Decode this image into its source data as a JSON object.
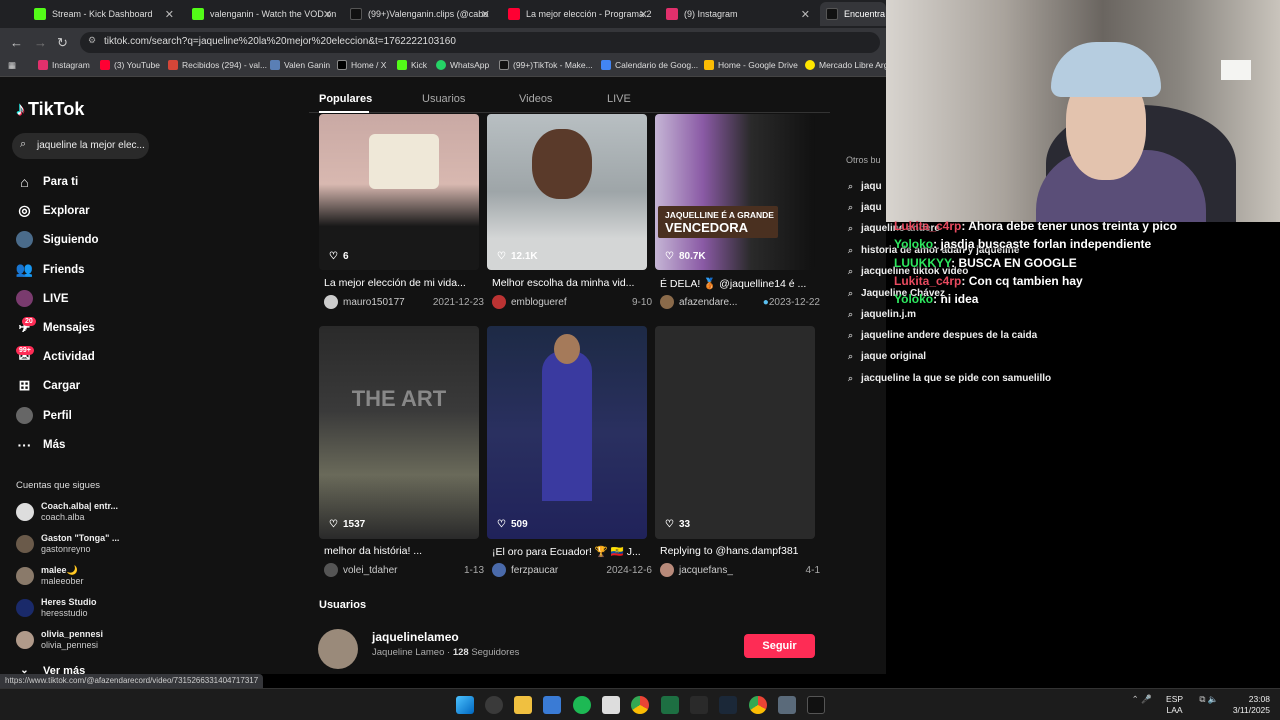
{
  "browser": {
    "tabs": [
      {
        "title": "Stream - Kick Dashboard",
        "color": "#53fc18"
      },
      {
        "title": "valenganin - Watch the VOD on",
        "color": "#53fc18"
      },
      {
        "title": "(99+)Valenganin.clips (@cabo",
        "color": "#000000"
      },
      {
        "title": "La mejor elección - Programa 2",
        "color": "#ff0033"
      },
      {
        "title": "(9) Instagram",
        "color": "#e1306c"
      },
      {
        "title": "Encuentra 'ja",
        "color": "#000000"
      }
    ],
    "url": "tiktok.com/search?q=jaqueline%20la%20mejor%20eleccion&t=1762222103160",
    "bookmarks": [
      "Instagram",
      "(3) YouTube",
      "Recibidos (294) - val...",
      "Valen Ganin",
      "Home / X",
      "Kick",
      "WhatsApp",
      "(99+)TikTok - Make...",
      "Calendario de Goog...",
      "Home - Google Drive",
      "Mercado Libre Arg"
    ]
  },
  "tiktok": {
    "logo": "TikTok",
    "search_value": "jaqueline la mejor elec...",
    "nav": [
      {
        "label": "Para ti",
        "icon": "home-icon"
      },
      {
        "label": "Explorar",
        "icon": "compass-icon"
      },
      {
        "label": "Siguiendo",
        "icon": "following-icon"
      },
      {
        "label": "Friends",
        "icon": "friends-icon"
      },
      {
        "label": "LIVE",
        "icon": "live-icon"
      },
      {
        "label": "Mensajes",
        "icon": "messages-icon",
        "badge": "20"
      },
      {
        "label": "Actividad",
        "icon": "activity-icon",
        "badge": "99+"
      },
      {
        "label": "Cargar",
        "icon": "upload-icon"
      },
      {
        "label": "Perfil",
        "icon": "profile-icon"
      },
      {
        "label": "Más",
        "icon": "more-icon"
      }
    ],
    "following_header": "Cuentas que sigues",
    "following": [
      {
        "name": "Coach.alba| entr...",
        "handle": "coach.alba"
      },
      {
        "name": "Gaston \"Tonga\" ...",
        "handle": "gastonreyno"
      },
      {
        "name": "malee🌙",
        "handle": "maleeober"
      },
      {
        "name": "Heres Studio",
        "handle": "heresstudio"
      },
      {
        "name": "olivia_pennesi",
        "handle": "olivia_pennesi"
      }
    ],
    "see_more": "Ver más",
    "tabs": [
      "Populares",
      "Usuarios",
      "Videos",
      "LIVE"
    ],
    "videos": [
      {
        "likes": "6",
        "caption": "La mejor elección de mi vida...",
        "author": "mauro150177",
        "date": "2021-12-23"
      },
      {
        "likes": "12.1K",
        "caption": "Melhor escolha da minha vid...",
        "author": "emblogueref",
        "date": "9-10"
      },
      {
        "likes": "80.7K",
        "caption": "É DELA! 🥉 @jaquelline14 é ...",
        "author": "afazendare...",
        "date": "2023-12-22",
        "overlay_line1": "JAQUELLINE É A GRANDE",
        "overlay_line2": "VENCEDORA"
      },
      {
        "likes": "1537",
        "caption": "melhor da história! ...",
        "author": "volei_tdaher",
        "date": "1-13",
        "overlay_text": "THE ART"
      },
      {
        "likes": "509",
        "caption": "¡El oro para Ecuador! 🏆 🇪🇨 J...",
        "author": "ferzpaucar",
        "date": "2024-12-6"
      },
      {
        "likes": "33",
        "caption": "Replying to @hans.dampf381",
        "author": "jacquefans_",
        "date": "4-1"
      }
    ],
    "users_header": "Usuarios",
    "user": {
      "name": "jaquelinelameo",
      "display": "Jaqueline Lameo",
      "followers_count": "128",
      "followers_label": "Seguidores",
      "follow_label": "Seguir"
    },
    "others_header": "Otros bu",
    "suggestions": [
      "jaqu",
      "jaqu",
      "jaqueline andere",
      "historia de amor adan y jaqueline",
      "jacqueline tiktok video",
      "Jaqueline Chávez",
      "jaquelin.j.m",
      "jaqueline andere despues de la caida",
      "jaque original",
      "jacqueline la que se pide con samuelillo"
    ]
  },
  "chat": [
    {
      "user": "Lukita_c4rp",
      "msg": "Ahora debe tener unos treinta y pico"
    },
    {
      "user": "Yoloko",
      "msg": "jasdja buscaste forlan independiente"
    },
    {
      "user": "LUUKKYY",
      "msg": "BUSCA EN GOOGLE"
    },
    {
      "user": "Lukita_c4rp",
      "msg": "Con cq tambien hay"
    },
    {
      "user": "Yoloko",
      "msg": "ni idea"
    }
  ],
  "status_url": "https://www.tiktok.com/@afazendarecord/video/7315266331404717317",
  "tray": {
    "lang1": "ESP",
    "lang2": "LAA",
    "time": "23:08",
    "date": "3/11/2025"
  }
}
